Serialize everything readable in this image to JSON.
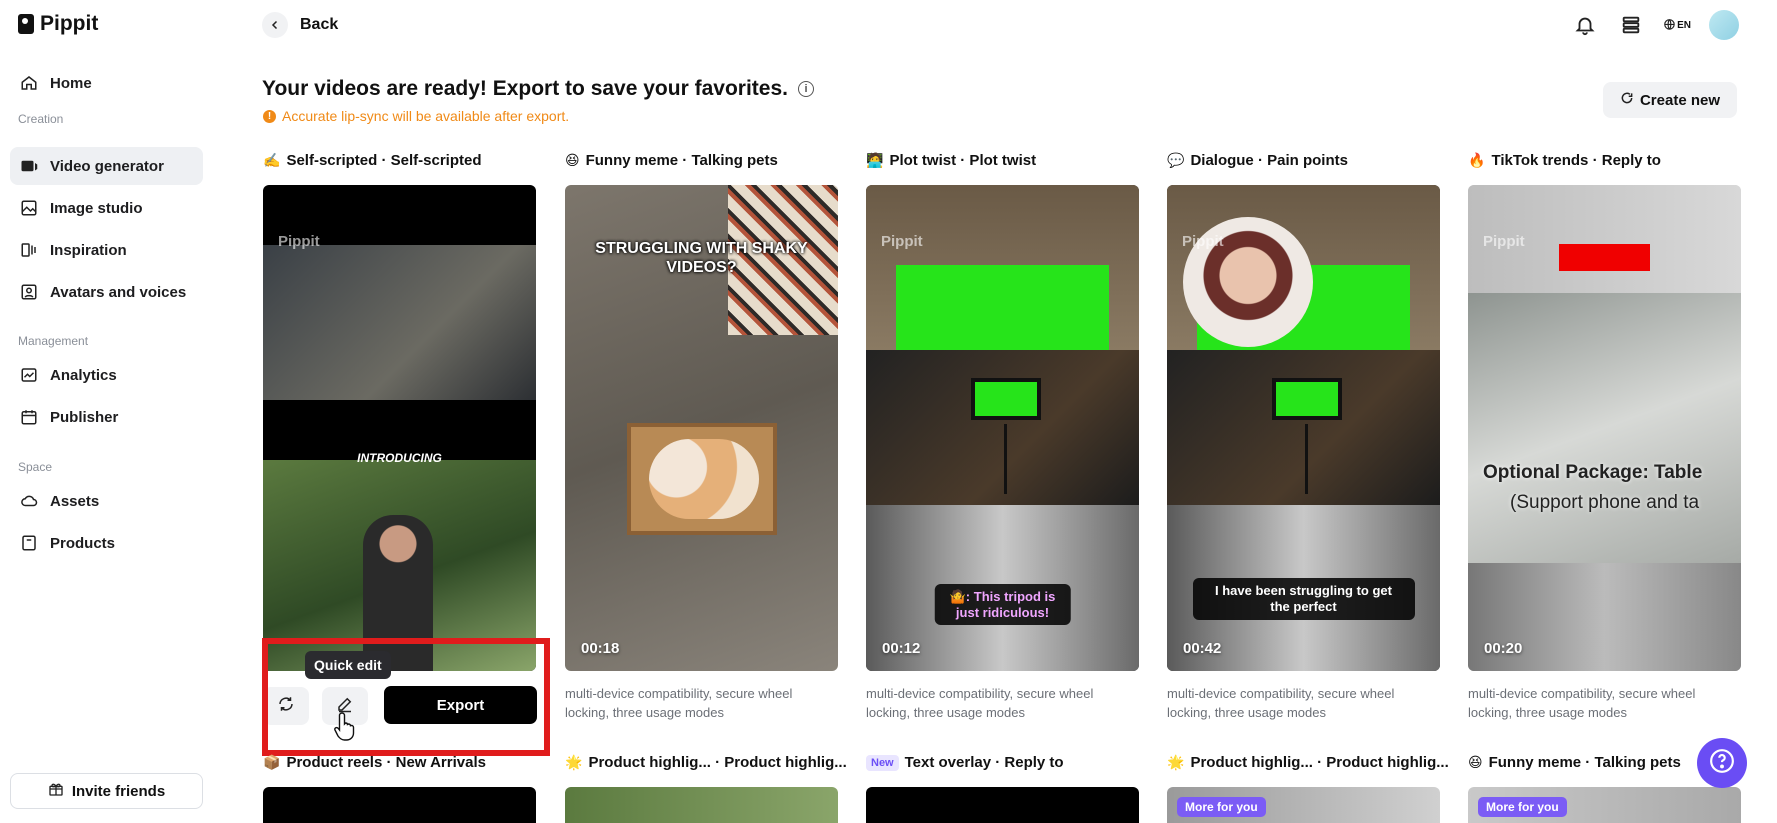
{
  "brand": {
    "name": "Pippit"
  },
  "sidebar": {
    "home": "Home",
    "sections": {
      "creation": "Creation",
      "management": "Management",
      "space": "Space"
    },
    "items": {
      "video_generator": "Video generator",
      "image_studio": "Image studio",
      "inspiration": "Inspiration",
      "avatars_voices": "Avatars and voices",
      "analytics": "Analytics",
      "publisher": "Publisher",
      "assets": "Assets",
      "products": "Products"
    },
    "invite": "Invite friends"
  },
  "header": {
    "back": "Back",
    "lang": "EN"
  },
  "main": {
    "headline": "Your videos are ready! Export to save your favorites.",
    "info_icon": "i",
    "warning": "Accurate lip-sync will be available after export.",
    "create_new": "Create new",
    "watermark": "Pippit",
    "cards": [
      {
        "emoji": "✍️",
        "title": "Self-scripted · Self-scripted",
        "overlay_text": "INTRODUCING",
        "duration": "",
        "desc": ""
      },
      {
        "emoji": "😆",
        "title": "Funny meme · Talking pets",
        "overlay_text": "STRUGGLING WITH SHAKY VIDEOS?",
        "duration": "00:18",
        "desc": "multi-device compatibility, secure wheel locking, three usage modes"
      },
      {
        "emoji": "🧑‍💻",
        "title": "Plot twist · Plot twist",
        "caption": "🤷: This tripod is just ridiculous!",
        "duration": "00:12",
        "desc": "multi-device compatibility, secure wheel locking, three usage modes"
      },
      {
        "emoji": "💬",
        "title": "Dialogue · Pain points",
        "caption": "I have been struggling to get the perfect",
        "duration": "00:42",
        "desc": "multi-device compatibility, secure wheel locking, three usage modes"
      },
      {
        "emoji": "🔥",
        "title": "TikTok trends · Reply to",
        "overlay_line1": "Optional Package: Table",
        "overlay_line2": "(Support phone and ta",
        "duration": "00:20",
        "desc": "multi-device compatibility, secure wheel locking, three usage modes"
      }
    ],
    "row2": [
      {
        "emoji": "📦",
        "title": "Product reels · New Arrivals"
      },
      {
        "emoji": "🌟",
        "title": "Product highlig... · Product highlig..."
      },
      {
        "badge": "New",
        "title": "Text overlay · Reply to"
      },
      {
        "emoji": "🌟",
        "title": "Product highlig... · Product highlig...",
        "more": "More for you"
      },
      {
        "emoji": "😆",
        "title": "Funny meme · Talking pets",
        "more": "More for you"
      }
    ],
    "actions": {
      "tooltip": "Quick edit",
      "export": "Export"
    }
  },
  "colors": {
    "accent": "#6a4df4",
    "warning": "#f08a17",
    "highlight": "#e01c1c"
  }
}
